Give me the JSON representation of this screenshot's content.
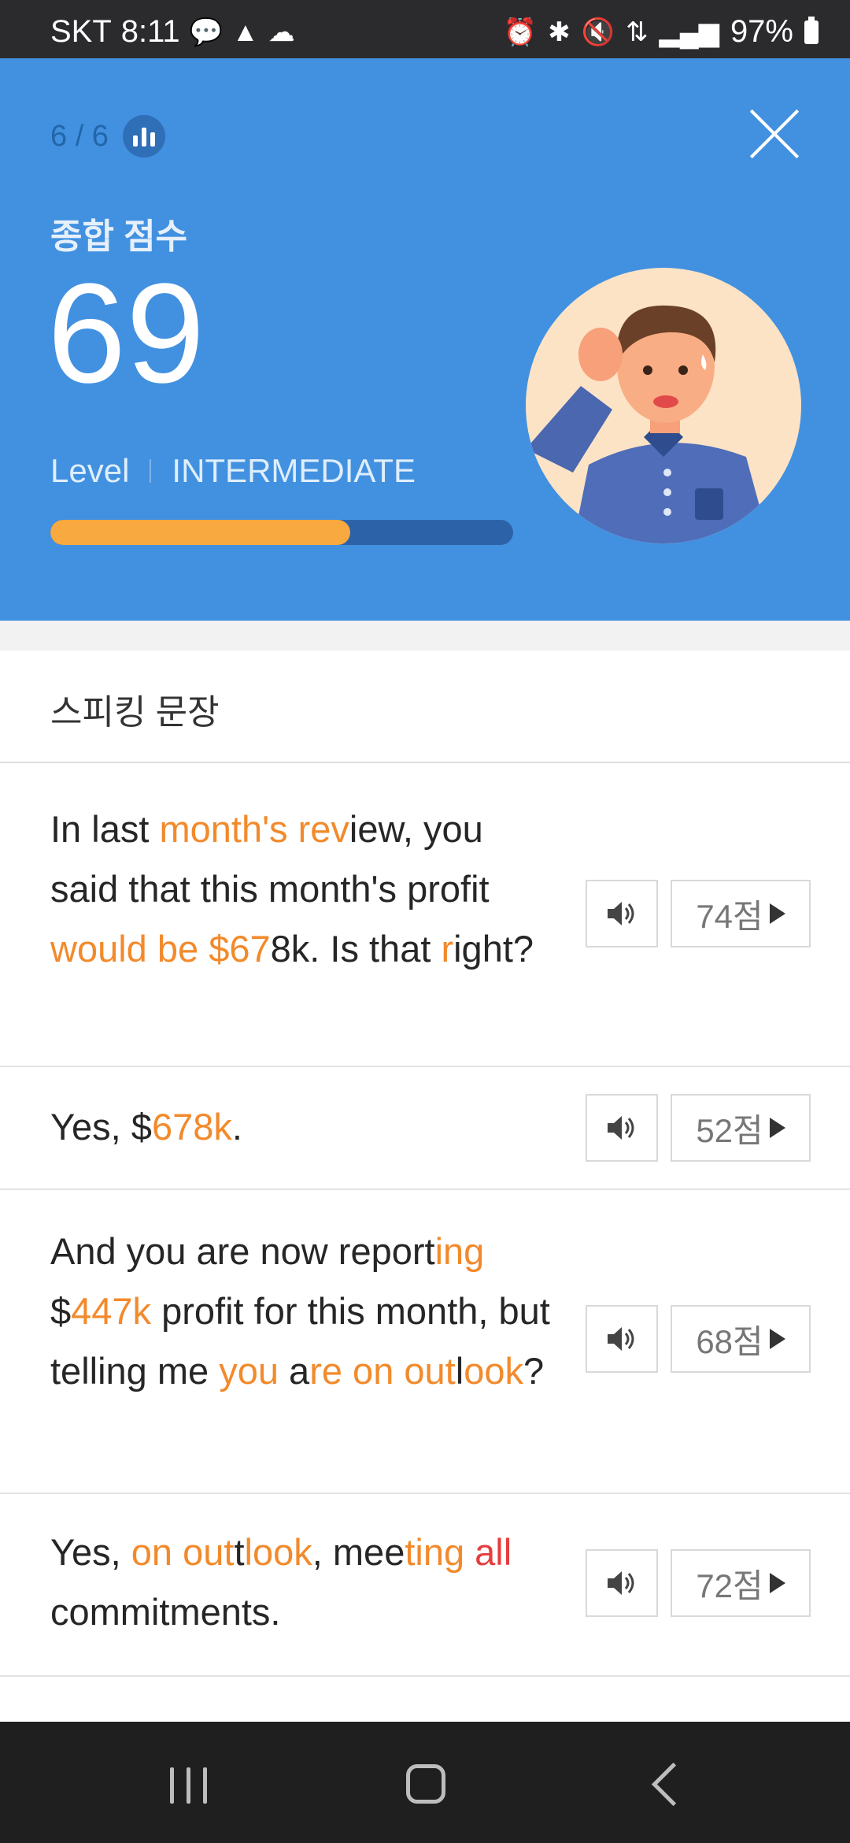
{
  "status_bar": {
    "carrier": "SKT",
    "time": "8:11",
    "battery": "97%"
  },
  "hero": {
    "progress": "6 / 6",
    "score_label": "종합 점수",
    "score": "69",
    "level_label": "Level",
    "level_value": "INTERMEDIATE",
    "level_progress_fraction": 0.69,
    "colors": {
      "background": "#4291e0",
      "bar_fill": "#f8a93f",
      "bar_track": "#2c63a8"
    }
  },
  "section": {
    "title": "스피킹 문장"
  },
  "sentences": [
    {
      "segments": [
        {
          "text": "In last ",
          "hl": false
        },
        {
          "text": "month's rev",
          "hl": true
        },
        {
          "text": "iew, you said that this month's profit ",
          "hl": false
        },
        {
          "text": "would be $67",
          "hl": true
        },
        {
          "text": "8k. Is that ",
          "hl": false
        },
        {
          "text": "r",
          "hl": true
        },
        {
          "text": "ight?",
          "hl": false
        }
      ],
      "score": "74점"
    },
    {
      "segments": [
        {
          "text": "Yes, $",
          "hl": false
        },
        {
          "text": "678k",
          "hl": true
        },
        {
          "text": ".",
          "hl": false
        }
      ],
      "score": "52점"
    },
    {
      "segments": [
        {
          "text": "And you are now report",
          "hl": false
        },
        {
          "text": "ing",
          "hl": true
        },
        {
          "text": " $",
          "hl": false
        },
        {
          "text": "447k",
          "hl": true
        },
        {
          "text": " profit for this month, but telling me ",
          "hl": false
        },
        {
          "text": "you",
          "hl": true
        },
        {
          "text": " a",
          "hl": false
        },
        {
          "text": "re on",
          "hl": true
        },
        {
          "text": " ",
          "hl": false
        },
        {
          "text": "out",
          "hl": true
        },
        {
          "text": "l",
          "hl": false
        },
        {
          "text": "ook",
          "hl": true
        },
        {
          "text": "?",
          "hl": false
        }
      ],
      "score": "68점"
    },
    {
      "segments": [
        {
          "text": "Yes, ",
          "hl": false
        },
        {
          "text": "on out",
          "hl": true
        },
        {
          "text": "t",
          "hl": false
        },
        {
          "text": "look",
          "hl": true
        },
        {
          "text": ", mee",
          "hl": false
        },
        {
          "text": "ting ",
          "hl": true
        },
        {
          "text": "all",
          "hl": "red"
        },
        {
          "text": " commitments.",
          "hl": false
        }
      ],
      "score": "72점"
    }
  ]
}
